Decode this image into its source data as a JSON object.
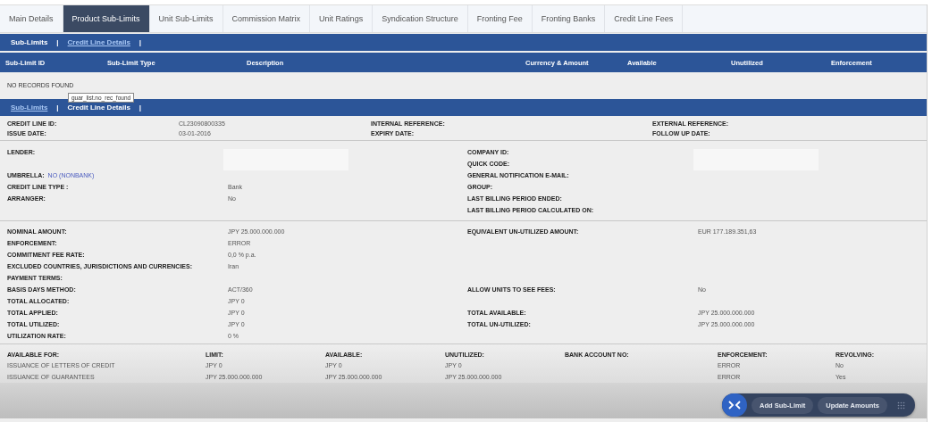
{
  "tabs": [
    {
      "label": "Main Details",
      "selected": false
    },
    {
      "label": "Product Sub-Limits",
      "selected": true
    },
    {
      "label": "Unit Sub-Limits",
      "selected": false
    },
    {
      "label": "Commission Matrix",
      "selected": false
    },
    {
      "label": "Unit Ratings",
      "selected": false
    },
    {
      "label": "Syndication Structure",
      "selected": false
    },
    {
      "label": "Fronting Fee",
      "selected": false
    },
    {
      "label": "Fronting Banks",
      "selected": false
    },
    {
      "label": "Credit Line Fees",
      "selected": false
    }
  ],
  "sub_limits_nav": [
    {
      "kind": "link",
      "label": "Sub-Limits",
      "selected": true
    },
    {
      "kind": "separator",
      "label": "|"
    },
    {
      "kind": "link",
      "label": "Credit Line Details",
      "selected": false
    },
    {
      "kind": "separator",
      "label": "|"
    }
  ],
  "sub_limits_table": {
    "columns": [
      "Sub-Limit ID",
      "Sub-Limit Type",
      "Description",
      "Currency & Amount",
      "Available",
      "Unutilized",
      "Enforcement"
    ],
    "empty_message": "NO RECORDS FOUND",
    "tooltip": "guar_list.no_rec_found"
  },
  "details_nav": [
    {
      "kind": "link",
      "label": "Sub-Limits",
      "selected": false
    },
    {
      "kind": "separator",
      "label": "|"
    },
    {
      "kind": "link",
      "label": "Credit Line Details",
      "selected": true
    },
    {
      "kind": "separator",
      "label": "|"
    }
  ],
  "header_fields": [
    [
      {
        "label": "CREDIT LINE ID:",
        "value": "CL23090800335"
      },
      {
        "label": "INTERNAL REFERENCE:"
      },
      {
        "label": "EXTERNAL REFERENCE:"
      }
    ],
    [
      {
        "label": "ISSUE DATE:",
        "value": "03-01-2016"
      },
      {
        "label": "EXPIRY DATE:"
      },
      {
        "label": "FOLLOW UP DATE:"
      }
    ]
  ],
  "party_rows": [
    {
      "left": {
        "label": "LENDER:",
        "redacted": true
      },
      "right": {
        "label": "COMPANY ID:",
        "redacted": true
      }
    },
    {
      "right": {
        "label": "QUICK CODE:"
      }
    },
    {
      "left": {
        "kind": "inline",
        "label": "UMBRELLA:",
        "value": "NO (NONBANK)"
      },
      "right": {
        "label": "GENERAL NOTIFICATION E-MAIL:"
      }
    },
    {
      "left": {
        "label": "CREDIT LINE TYPE :",
        "value": "Bank"
      },
      "right": {
        "label": "GROUP:"
      }
    },
    {
      "left": {
        "label": "ARRANGER:",
        "value": "No"
      },
      "right": {
        "label": "LAST BILLING PERIOD ENDED:"
      }
    },
    {
      "right": {
        "label": "LAST BILLING PERIOD CALCULATED ON:"
      }
    }
  ],
  "amount_rows": [
    {
      "left": {
        "label": "NOMINAL AMOUNT:",
        "value": "JPY  25.000.000.000"
      },
      "right": {
        "label": "EQUIVALENT UN-UTILIZED AMOUNT:",
        "value": "EUR  177.189.351,63"
      }
    },
    {
      "left": {
        "label": "ENFORCEMENT:",
        "value": "ERROR"
      }
    },
    {
      "left": {
        "label": "COMMITMENT FEE RATE:",
        "value": "0,0 % p.a."
      }
    },
    {
      "left": {
        "label": "EXCLUDED COUNTRIES, JURISDICTIONS AND CURRENCIES:",
        "value": "Iran"
      }
    },
    {
      "left": {
        "label": "PAYMENT TERMS:"
      }
    },
    {
      "left": {
        "label": "BASIS DAYS METHOD:",
        "value": "ACT/360"
      },
      "right": {
        "label": "ALLOW UNITS TO SEE FEES:",
        "value": "No"
      }
    },
    {
      "left": {
        "label": "TOTAL ALLOCATED:",
        "value": "JPY  0"
      }
    },
    {
      "left": {
        "label": "TOTAL APPLIED:",
        "value": "JPY  0"
      },
      "right": {
        "label": "TOTAL AVAILABLE:",
        "value": "JPY  25.000.000.000"
      }
    },
    {
      "left": {
        "label": "TOTAL UTILIZED:",
        "value": "JPY  0"
      },
      "right": {
        "label": "TOTAL UN-UTILIZED:",
        "value": "JPY  25.000.000.000"
      }
    },
    {
      "left": {
        "label": "UTILIZATION RATE:",
        "value": "0 %"
      }
    }
  ],
  "availability_table": {
    "columns": [
      "AVAILABLE FOR:",
      "LIMIT:",
      "AVAILABLE:",
      "UNUTILIZED:",
      "BANK ACCOUNT NO:",
      "ENFORCEMENT:",
      "REVOLVING:"
    ],
    "rows": [
      [
        "ISSUANCE OF LETTERS OF CREDIT",
        "JPY  0",
        "JPY  0",
        "JPY  0",
        "",
        "ERROR",
        "No"
      ],
      [
        "ISSUANCE OF GUARANTEES",
        "JPY  25.000.000.000",
        "JPY  25.000.000.000",
        "JPY  25.000.000.000",
        "",
        "ERROR",
        "Yes"
      ]
    ]
  },
  "toolbar": {
    "buttons": [
      "Add Sub-Limit",
      "Update Amounts"
    ]
  }
}
